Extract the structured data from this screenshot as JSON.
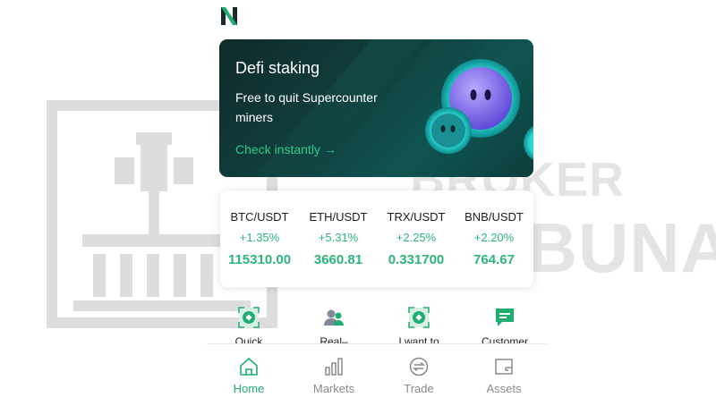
{
  "banner": {
    "title": "Defi staking",
    "subtitle": "Free to quit Supercounter miners",
    "cta": "Check instantly →"
  },
  "tickers": [
    {
      "pair": "BTC/USDT",
      "change": "+1.35%",
      "price": "115310.00"
    },
    {
      "pair": "ETH/USDT",
      "change": "+5.31%",
      "price": "3660.81"
    },
    {
      "pair": "TRX/USDT",
      "change": "+2.25%",
      "price": "0.331700"
    },
    {
      "pair": "BNB/USDT",
      "change": "+2.20%",
      "price": "764.67"
    }
  ],
  "quick_actions": [
    {
      "label": "Quick",
      "icon": "coin-exchange-icon"
    },
    {
      "label": "Real–",
      "icon": "users-icon"
    },
    {
      "label": "I want to",
      "icon": "coin-exchange-icon"
    },
    {
      "label": "Customer",
      "icon": "chat-icon"
    }
  ],
  "tabs": [
    {
      "label": "Home",
      "icon": "home-icon",
      "active": true
    },
    {
      "label": "Markets",
      "icon": "bar-chart-icon",
      "active": false
    },
    {
      "label": "Trade",
      "icon": "exchange-icon",
      "active": false
    },
    {
      "label": "Assets",
      "icon": "wallet-icon",
      "active": false
    }
  ],
  "watermark": {
    "line1": "BROKER",
    "line2": "TRIBUNAL"
  },
  "colors": {
    "accent": "#1fae72",
    "banner_bg": "#10403f",
    "positive": "#2db57a"
  }
}
